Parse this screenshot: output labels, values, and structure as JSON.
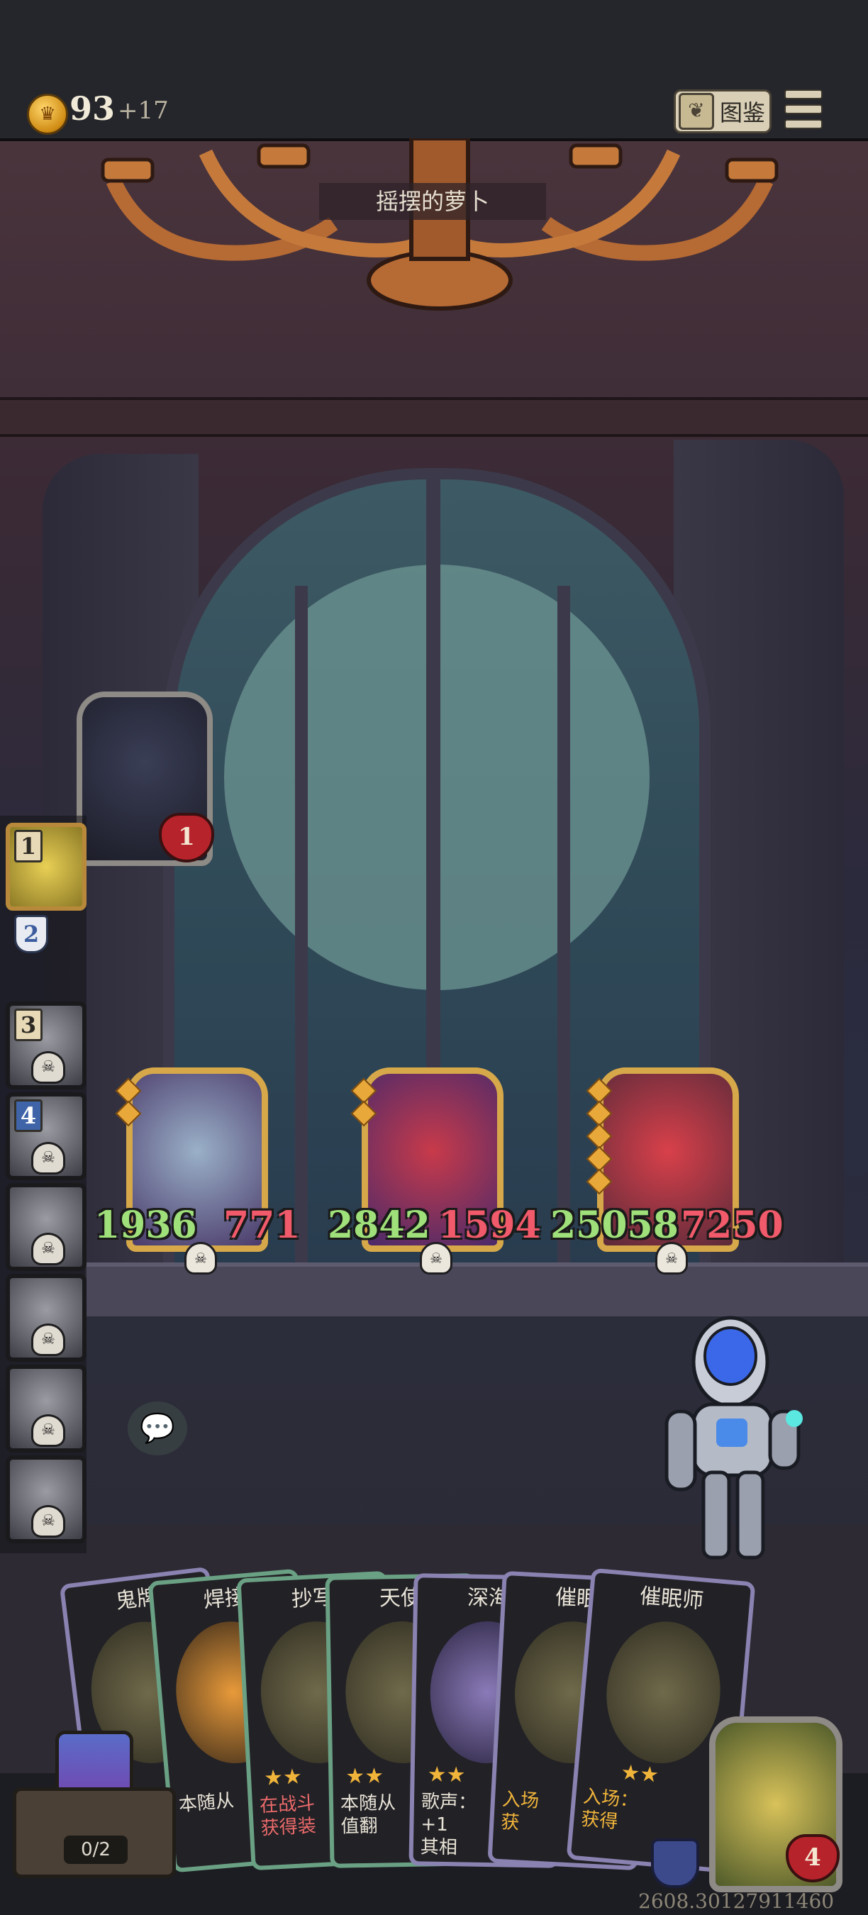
{
  "header": {
    "gold": "93",
    "gold_income": "+17",
    "codex_label": "图鉴",
    "codex_icon": "book-icon",
    "menu_icon": "hamburger-menu-icon"
  },
  "location": "摇摆的萝卜",
  "opponent": {
    "health": "1"
  },
  "roster": [
    {
      "badge": "1",
      "state": "active"
    },
    {
      "badge": "2",
      "state": "pending"
    },
    {
      "badge": "3",
      "state": "defeated"
    },
    {
      "badge": "4",
      "state": "defeated"
    },
    {
      "badge": "",
      "state": "defeated"
    },
    {
      "badge": "",
      "state": "defeated"
    },
    {
      "badge": "",
      "state": "defeated"
    },
    {
      "badge": "",
      "state": "defeated"
    }
  ],
  "enemies": [
    {
      "attack": "1936",
      "health": "771",
      "portrait": "horned-beast-icon"
    },
    {
      "attack": "2842",
      "health": "1594",
      "portrait": "jester-icon"
    },
    {
      "attack": "25058",
      "health": "7250",
      "portrait": "red-dragon-icon"
    }
  ],
  "hand": [
    {
      "title": "鬼牌",
      "stars": "",
      "desc": ""
    },
    {
      "title": "焊接",
      "stars": "",
      "desc": ""
    },
    {
      "title": "抄写",
      "stars": "★★",
      "desc": "在战斗\n获得装"
    },
    {
      "title": "天使",
      "stars": "★★",
      "desc": "本随从\n值翻"
    },
    {
      "title": "深海",
      "stars": "★★",
      "desc": "歌声：\n+1\n其相"
    },
    {
      "title": "催眠",
      "stars": "",
      "desc": "入场\n获"
    },
    {
      "title": "催眠师",
      "stars": "★★",
      "desc": "入场：\n获得"
    }
  ],
  "hand_desc_extra": "本随从",
  "chest": {
    "count": "0/2"
  },
  "player": {
    "health": "4"
  },
  "build_id": "2608.30127911460",
  "colors": {
    "attack": "#9fe07a",
    "health": "#f05a6a",
    "gold_frame": "#d6a84a",
    "heart": "#b7232b"
  }
}
